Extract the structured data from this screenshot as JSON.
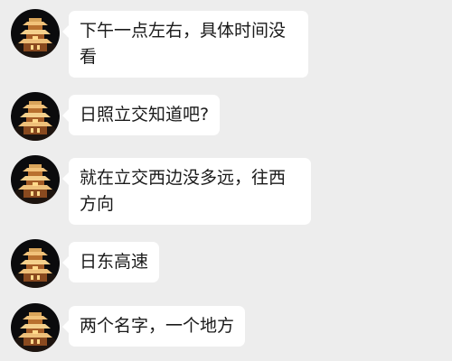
{
  "colors": {
    "background": "#ededed",
    "bubble": "#ffffff",
    "text": "#1a1a1a"
  },
  "avatar": {
    "icon": "pagoda-night-avatar-icon"
  },
  "messages": [
    {
      "text": "下午一点左右，具体时间没看"
    },
    {
      "text": "日照立交知道吧?"
    },
    {
      "text": "就在立交西边没多远，往西方向"
    },
    {
      "text": "日东高速"
    },
    {
      "text": "两个名字，一个地方"
    }
  ]
}
